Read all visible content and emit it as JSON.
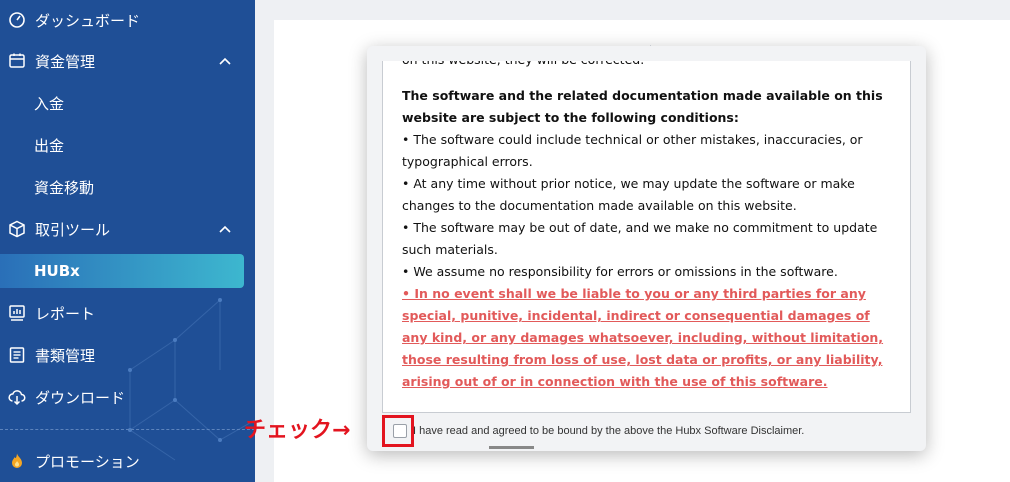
{
  "sidebar": {
    "items": [
      {
        "label": "ダッシュボード",
        "icon": "dashboard-gauge-icon"
      },
      {
        "label": "資金管理",
        "icon": "calendar-wallet-icon",
        "expanded": true
      },
      {
        "label": "入金"
      },
      {
        "label": "出金"
      },
      {
        "label": "資金移動"
      },
      {
        "label": "取引ツール",
        "icon": "cube-icon",
        "expanded": true
      },
      {
        "label": "HUBx",
        "active": true
      },
      {
        "label": "レポート",
        "icon": "report-chart-icon"
      },
      {
        "label": "書類管理",
        "icon": "document-list-icon"
      },
      {
        "label": "ダウンロード",
        "icon": "cloud-download-icon"
      },
      {
        "label": "プロモーション",
        "icon": "fire-icon"
      }
    ]
  },
  "modal": {
    "lines": [
      "on this website, they will be corrected.",
      "The software and the related documentation made available on this website are subject to the following conditions:",
      "• The software could include technical or other mistakes, inaccuracies, or typographical errors.",
      "• At any time without prior notice, we may update the software or make changes to the documentation made available on this website.",
      "• The software may be out of date, and we make no commitment to update such materials.",
      "• We assume no responsibility for errors or omissions in the software.",
      "• In no event shall we be liable to you or any third parties for any special, punitive, incidental, indirect or consequential damages of any kind, or any damages whatsoever, including, without limitation, those resulting from loss of use, lost data or profits, or any liability, arising out of or in connection with the use of this software."
    ],
    "agree_text": "I have read and agreed to be bound by the above the Hubx Software Disclaimer."
  },
  "annotation": {
    "label": "チェック→"
  },
  "colors": {
    "sidebar_bg": "#1f4f96",
    "active_gradient_start": "#2a6fb8",
    "active_gradient_end": "#3db7cf",
    "disclaimer_red": "#e25a5a",
    "annotation_red": "#e3141f"
  }
}
